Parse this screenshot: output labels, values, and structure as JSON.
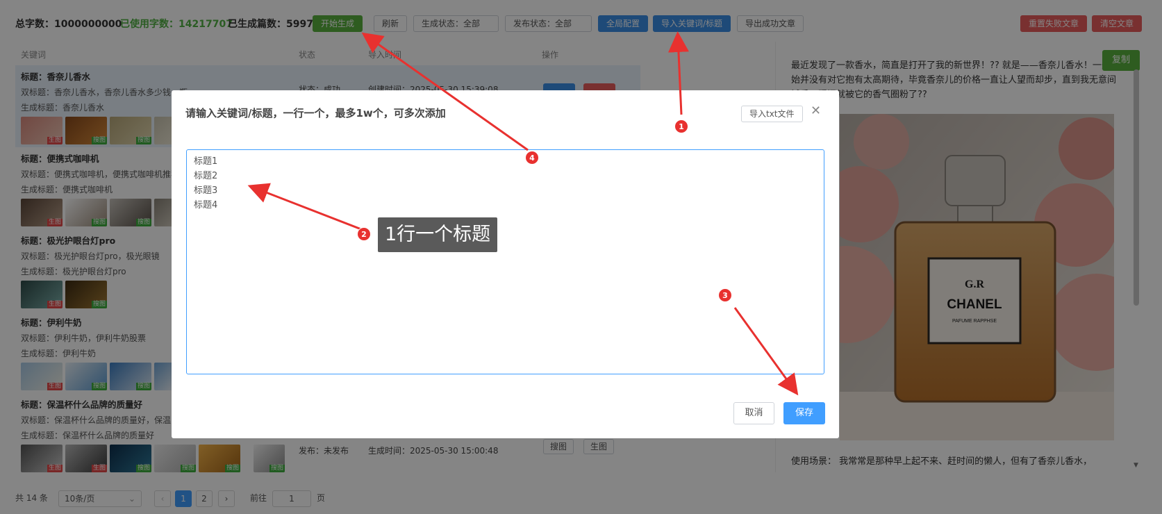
{
  "toolbar": {
    "total_label": "总字数：1000000000",
    "used_label": "已使用字数：14217707",
    "generated_label": "已生成篇数：5997",
    "start_btn": "开始生成",
    "refresh_btn": "刷新",
    "gen_status": "生成状态：全部",
    "pub_status": "发布状态：全部",
    "global_cfg_btn": "全局配置",
    "import_kw_btn": "导入关键词/标题",
    "export_btn": "导出成功文章",
    "reset_failed_btn": "重置失败文章",
    "clear_btn": "清空文章"
  },
  "table": {
    "headers": [
      "关键词",
      "状态",
      "导入时间",
      "操作"
    ],
    "rows": [
      {
        "title": "标题：香奈儿香水",
        "sub": "双标题：香奈儿香水，香奈儿香水多少钱一瓶",
        "gen": "生成标题：香奈儿香水",
        "status": "状态：成功",
        "time": "创建时间：2025-05-30 15:39:08"
      },
      {
        "title": "标题：便携式咖啡机",
        "sub": "双标题：便携式咖啡机，便携式咖啡机推荐",
        "gen": "生成标题：便携式咖啡机"
      },
      {
        "title": "标题：极光护眼台灯pro",
        "sub": "双标题：极光护眼台灯pro，极光眼镜",
        "gen": "生成标题：极光护眼台灯pro"
      },
      {
        "title": "标题：伊利牛奶",
        "sub": "双标题：伊利牛奶，伊利牛奶股票",
        "gen": "生成标题：伊利牛奶"
      },
      {
        "title": "标题：保温杯什么品牌的质量好",
        "sub": "双标题：保温杯什么品牌的质量好，保温",
        "gen": "生成标题：保温杯什么品牌的质量好",
        "publish": "发布：未发布",
        "gen_time": "生成时间：2025-05-30 15:00:48"
      }
    ],
    "tag_gen": "生图",
    "tag_search": "搜图",
    "btn_search": "搜图",
    "btn_gen": "生图"
  },
  "pager": {
    "total": "共 14 条",
    "page_size": "10条/页",
    "pages": [
      "1",
      "2"
    ],
    "goto_label": "前往",
    "goto_value": "1",
    "page_unit": "页"
  },
  "right": {
    "copy_btn": "复制",
    "para1": "最近发现了一款香水，简直是打开了我的新世界！?? 就是——香奈儿香水！一开始并没有对它抱有太高期待，毕竟香奈儿的价格一直让人望而却步，直到我无意间试香，瞬间就被它的香气圈粉了??",
    "para2": "使用场景： 我常常是那种早上起不来、赶时间的懒人，但有了香奈儿香水，",
    "bottle_label1": "G.R",
    "bottle_label2": "CHANEL",
    "bottle_label3": "PAFUME RAPPHSE"
  },
  "modal": {
    "title": "请输入关键词/标题，一行一个，最多1w个，可多次添加",
    "import_txt": "导入txt文件",
    "textarea_value": "标题1\n标题2\n标题3\n标题4",
    "cancel": "取消",
    "save": "保存"
  },
  "annotations": {
    "badges": [
      "1",
      "2",
      "3",
      "4"
    ],
    "callout": "1行一个标题",
    "color": "#e8312f"
  }
}
